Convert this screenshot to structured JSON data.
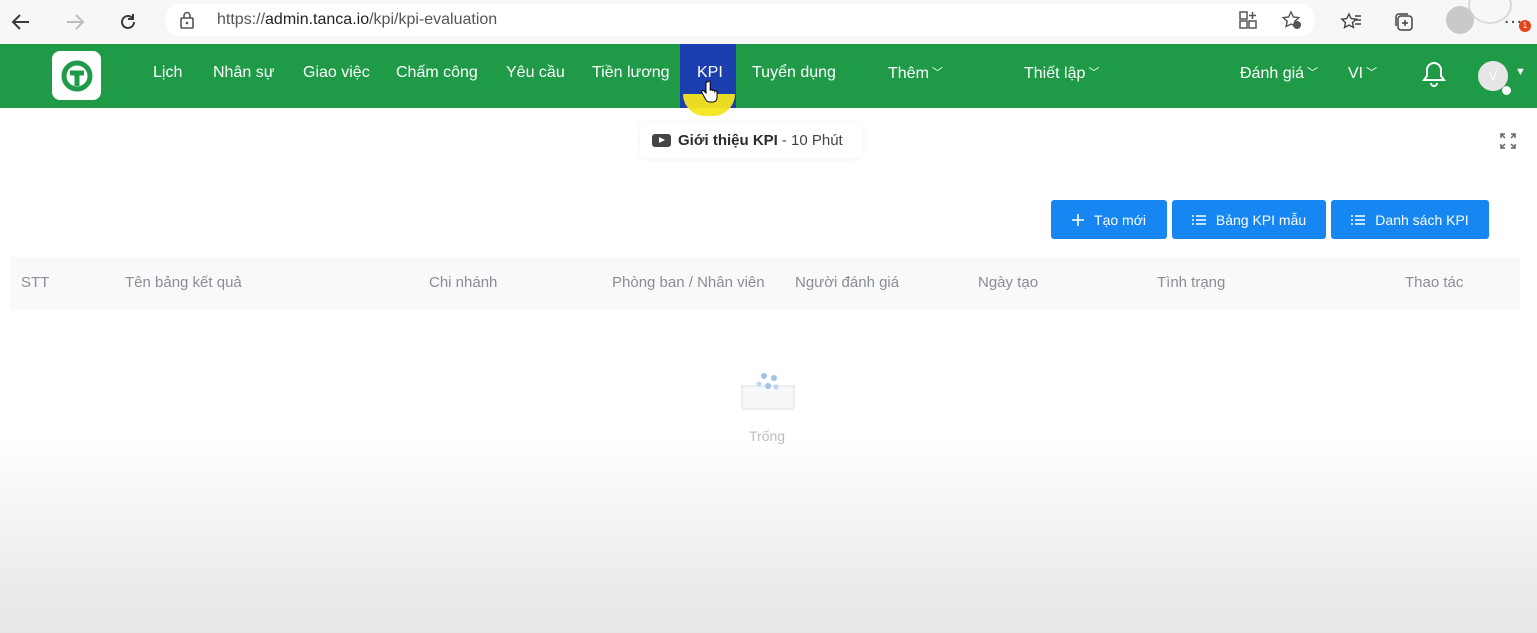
{
  "browser": {
    "url_prefix": "https://",
    "url_host": "admin.tanca.io",
    "url_path": "/kpi/kpi-evaluation",
    "notification_badge": "1"
  },
  "nav": {
    "items": [
      {
        "label": "Lịch"
      },
      {
        "label": "Nhân sự"
      },
      {
        "label": "Giao việc"
      },
      {
        "label": "Chấm công"
      },
      {
        "label": "Yêu cầu"
      },
      {
        "label": "Tiền lương"
      },
      {
        "label": "KPI"
      },
      {
        "label": "Tuyển dụng"
      },
      {
        "label": "Thêm"
      },
      {
        "label": "Thiết lập"
      }
    ],
    "feedback_label": "Đánh giá",
    "language": "VI",
    "user_initial": "V"
  },
  "intro": {
    "title": "Giới thiệu KPI",
    "duration": "- 10 Phút"
  },
  "actions": {
    "create": "Tạo mới",
    "template": "Bảng KPI mẫu",
    "list": "Danh sách KPI"
  },
  "table": {
    "columns": [
      "STT",
      "Tên bảng kết quả",
      "Chi nhánh",
      "Phòng ban / Nhân viên",
      "Người đánh giá",
      "Ngày tạo",
      "Tình trạng",
      "Thao tác"
    ],
    "empty_text": "Trống"
  },
  "colors": {
    "nav_green": "#1f9a47",
    "kpi_active": "#1b3fae",
    "button_blue": "#1586f2"
  }
}
